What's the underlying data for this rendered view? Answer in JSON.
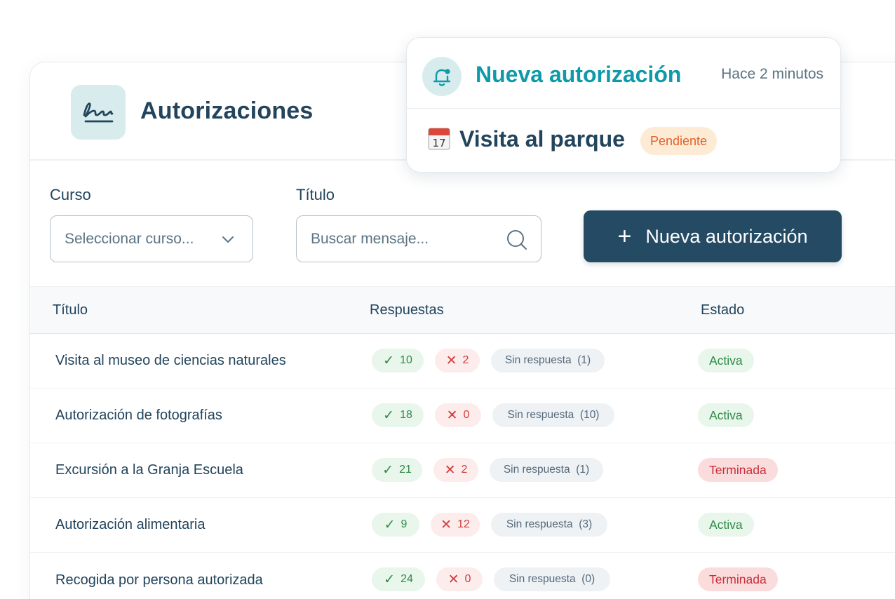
{
  "header": {
    "title": "Autorizaciones",
    "logo_icon": "signature-icon"
  },
  "filters": {
    "course_label": "Curso",
    "course_placeholder": "Seleccionar curso...",
    "title_label": "Título",
    "title_placeholder": "Buscar mensaje..."
  },
  "actions": {
    "new_label": "Nueva autorización",
    "new_icon": "plus-icon"
  },
  "table": {
    "columns": [
      "Título",
      "Respuestas",
      "Estado"
    ],
    "rows": [
      {
        "title": "Visita al museo de ciencias naturales",
        "yes": "10",
        "no": "2",
        "none_label": "Sin respuesta",
        "none_count": "(1)",
        "status": "Activa",
        "status_kind": "active"
      },
      {
        "title": "Autorización de fotografías",
        "yes": "18",
        "no": "0",
        "none_label": "Sin respuesta",
        "none_count": "(10)",
        "status": "Activa",
        "status_kind": "active"
      },
      {
        "title": "Excursión a la Granja Escuela",
        "yes": "21",
        "no": "2",
        "none_label": "Sin respuesta",
        "none_count": "(1)",
        "status": "Terminada",
        "status_kind": "ended"
      },
      {
        "title": "Autorización alimentaria",
        "yes": "9",
        "no": "12",
        "none_label": "Sin respuesta",
        "none_count": "(3)",
        "status": "Activa",
        "status_kind": "active"
      },
      {
        "title": "Recogida por persona autorizada",
        "yes": "24",
        "no": "0",
        "none_label": "Sin respuesta",
        "none_count": "(0)",
        "status": "Terminada",
        "status_kind": "ended"
      }
    ]
  },
  "notification": {
    "title": "Nueva autorización",
    "time": "Hace 2 minutos",
    "event": "Visita al parque",
    "event_icon": "calendar-icon",
    "badge": "Pendiente"
  },
  "colors": {
    "primary": "#244b63",
    "accent": "#0e9aa8",
    "success": "#2f8a46",
    "danger": "#d33b3b",
    "pending": "#e2602b"
  }
}
